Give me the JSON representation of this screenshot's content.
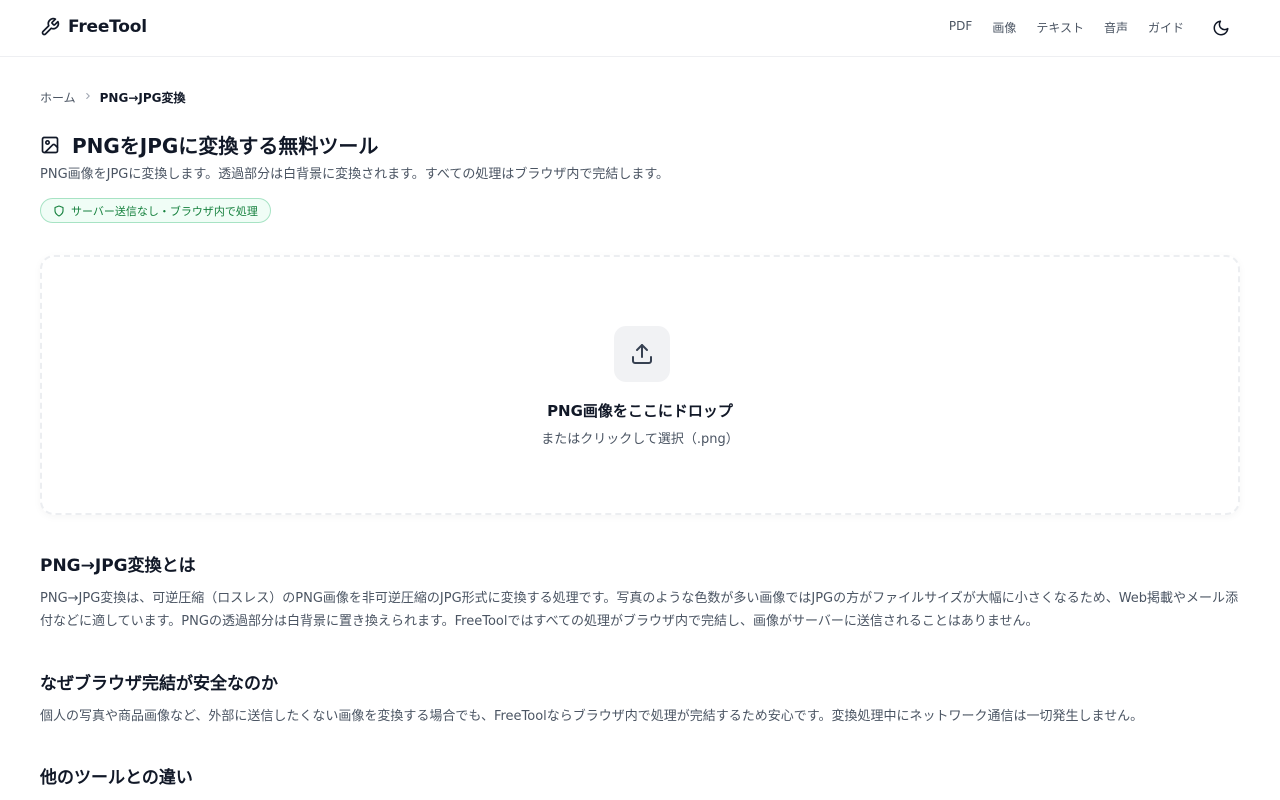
{
  "header": {
    "logo_text": "FreeTool",
    "nav": [
      "PDF",
      "画像",
      "テキスト",
      "音声",
      "ガイド"
    ]
  },
  "breadcrumb": {
    "home": "ホーム",
    "current": "PNG→JPG変換"
  },
  "page": {
    "title": "PNGをJPGに変換する無料ツール",
    "description": "PNG画像をJPGに変換します。透過部分は白背景に変換されます。すべての処理はブラウザ内で完結します。",
    "badge": "サーバー送信なし・ブラウザ内で処理"
  },
  "dropzone": {
    "title": "PNG画像をここにドロップ",
    "subtitle": "またはクリックして選択（.png）"
  },
  "sections": [
    {
      "heading": "PNG→JPG変換とは",
      "body": "PNG→JPG変換は、可逆圧縮（ロスレス）のPNG画像を非可逆圧縮のJPG形式に変換する処理です。写真のような色数が多い画像ではJPGの方がファイルサイズが大幅に小さくなるため、Web掲載やメール添付などに適しています。PNGの透過部分は白背景に置き換えられます。FreeToolではすべての処理がブラウザ内で完結し、画像がサーバーに送信されることはありません。"
    },
    {
      "heading": "なぜブラウザ完結が安全なのか",
      "body": "個人の写真や商品画像など、外部に送信したくない画像を変換する場合でも、FreeToolならブラウザ内で処理が完結するため安心です。変換処理中にネットワーク通信は一切発生しません。"
    },
    {
      "heading": "他のツールとの違い"
    }
  ],
  "colors": {
    "badge_green": "#15803d",
    "badge_bg": "#f0fdf6",
    "text_primary": "#111827",
    "text_secondary": "#4b5563"
  }
}
